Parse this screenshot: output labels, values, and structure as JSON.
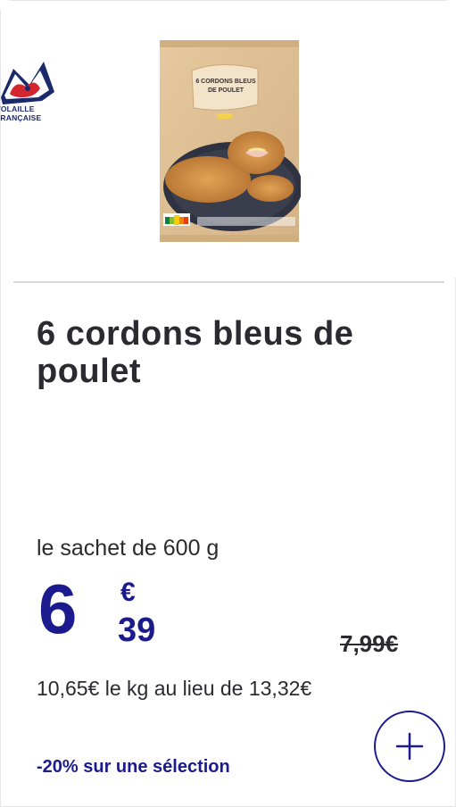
{
  "product": {
    "title": "6 cordons bleus de poulet",
    "package_text_line1": "6 CORDONS BLEUS",
    "package_text_line2": "DE POULET",
    "brand_logo_text": "VOLAILLE FRANÇAISE"
  },
  "pricing": {
    "unit": "le sachet de 600 g",
    "price_integer": "6",
    "price_currency": "€",
    "price_decimal": "39",
    "old_price": "7,99€",
    "per_kg": "10,65€ le kg au lieu de 13,32€",
    "promo": "-20% sur une sélection"
  },
  "actions": {
    "add_icon": "plus-icon"
  },
  "colors": {
    "accent": "#1b1b8e",
    "text": "#2a2a30"
  }
}
